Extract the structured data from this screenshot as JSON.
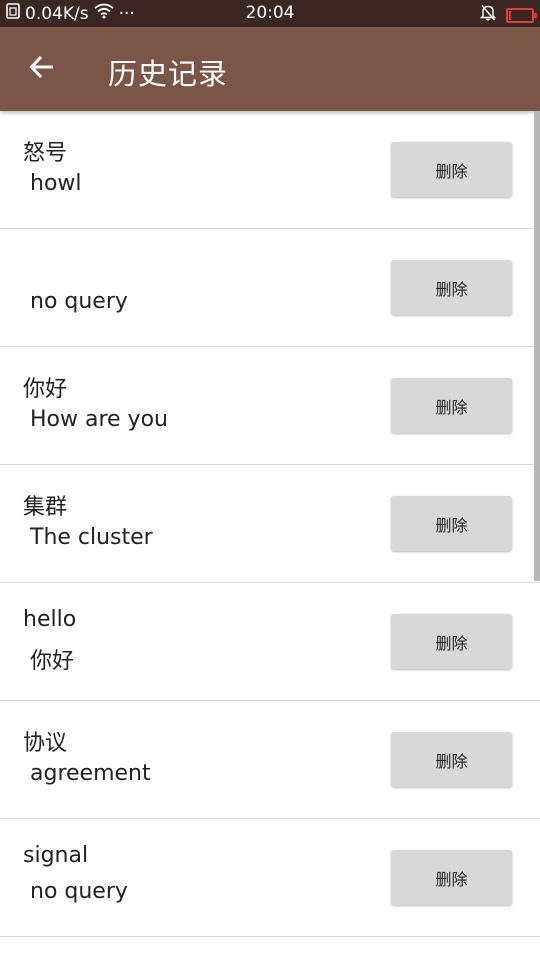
{
  "status_bar": {
    "network_speed": "0.04K/s",
    "more": "···",
    "time": "20:04",
    "battery_level": 0.1,
    "battery_color": "#e53935",
    "icons": [
      "sim-icon",
      "wifi-icon",
      "mute-bell-icon",
      "battery-icon"
    ]
  },
  "app_bar": {
    "title": "历史记录",
    "back_icon": "arrow-left-icon",
    "color": "#7b5647"
  },
  "history": [
    {
      "word": "怒号",
      "translation": "howl",
      "delete_label": "删除"
    },
    {
      "word": "",
      "translation": "no query",
      "delete_label": "删除"
    },
    {
      "word": "你好",
      "translation": "How are you",
      "delete_label": "删除"
    },
    {
      "word": "集群",
      "translation": "The cluster",
      "delete_label": "删除"
    },
    {
      "word": "hello",
      "translation": "你好",
      "delete_label": "删除"
    },
    {
      "word": "协议",
      "translation": "agreement",
      "delete_label": "删除"
    },
    {
      "word": "signal",
      "translation": "no query",
      "delete_label": "删除"
    }
  ]
}
